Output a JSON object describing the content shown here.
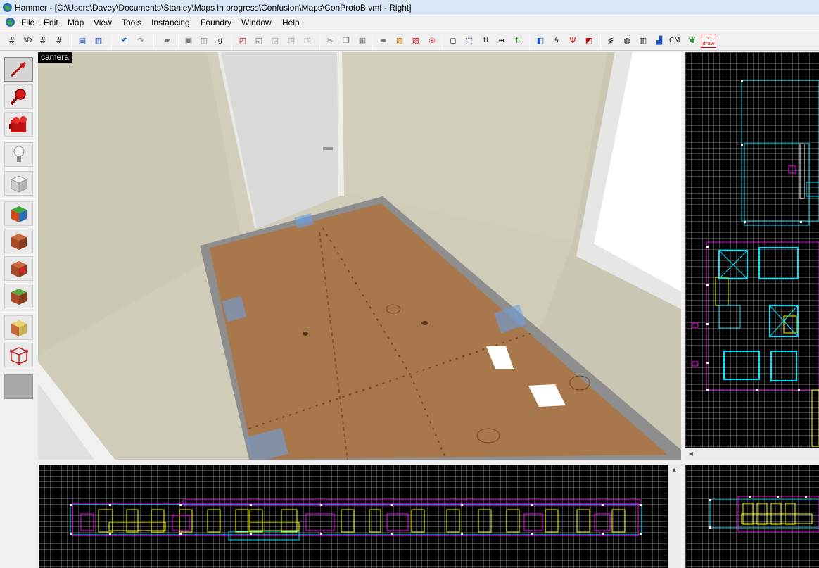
{
  "window": {
    "title": "Hammer - [C:\\Users\\Davey\\Documents\\Stanley\\Maps in progress\\Confusion\\Maps\\ConProtoB.vmf - Right]"
  },
  "menu": {
    "items": [
      "File",
      "Edit",
      "Map",
      "View",
      "Tools",
      "Instancing",
      "Foundry",
      "Window",
      "Help"
    ]
  },
  "toolbar": {
    "text_buttons": {
      "grid_ig": "ig",
      "texlock_tl": "tl",
      "cm": "CM",
      "nodraw_top": "no",
      "nodraw_bottom": "draw"
    },
    "icons": [
      "grid-icon",
      "3d-grid-icon",
      "grid-smaller-icon",
      "grid-larger-icon",
      "load-window-state-icon",
      "save-window-state-icon",
      "undo-icon",
      "redo-icon",
      "carve-icon",
      "group-icon",
      "ungroup-icon",
      "ignore-group-icon",
      "hide-selected-icon",
      "hide-unselected-icon",
      "unhide-icon",
      "hide-toggle-icon",
      "cut-icon",
      "copy-icon",
      "paste-icon",
      "box-icon",
      "hatch-icon",
      "hatch-alt-icon",
      "radius-icon",
      "selection-frame-icon",
      "selection-dashed-icon",
      "texture-lock-icon",
      "texture-scale-icon",
      "flip-icon",
      "door-icon",
      "lightning-icon",
      "r-icon",
      "entity-report-icon",
      "cordon-icon",
      "sphere-icon",
      "texture-browser-icon",
      "blue-square-icon",
      "cm-icon",
      "leaf-icon",
      "nodraw-icon"
    ]
  },
  "tools": {
    "items": [
      {
        "name": "selection-tool",
        "active": true
      },
      {
        "name": "magnify-tool",
        "active": false
      },
      {
        "name": "camera-tool",
        "active": false
      },
      {
        "name": "entity-tool",
        "active": false
      },
      {
        "name": "block-tool",
        "active": false
      },
      {
        "name": "toggle-texture-application-tool",
        "active": false
      },
      {
        "name": "apply-current-texture-tool",
        "active": false
      },
      {
        "name": "apply-decals-tool",
        "active": false
      },
      {
        "name": "apply-overlays-tool",
        "active": false
      },
      {
        "name": "clipping-tool",
        "active": false
      },
      {
        "name": "vertex-tool",
        "active": false
      },
      {
        "name": "extra-tool",
        "active": false
      }
    ]
  },
  "viewport_3d": {
    "label": "camera"
  },
  "colors": {
    "grid_background": "#000000",
    "grid_line": "#555555",
    "brush_cyan": "#00e5ff",
    "brush_magenta": "#ff00ff",
    "brush_yellow": "#ffff00",
    "brush_white": "#ffffff",
    "floor_wood": "#a9774c",
    "wall": "#cfcdb9"
  }
}
